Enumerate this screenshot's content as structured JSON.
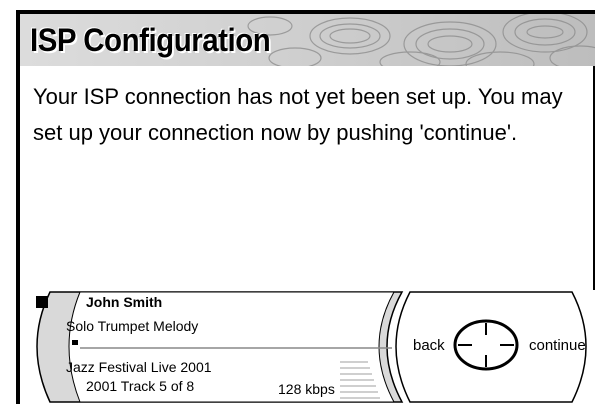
{
  "screen": {
    "title": "ISP Configuration",
    "message": "Your ISP connection has not yet been set up. You may set up your connection now by pushing 'continue'."
  },
  "player": {
    "artist": "John Smith",
    "track_title": "Solo Trumpet Melody",
    "album": "Jazz Festival Live 2001",
    "track_info": "2001   Track 5 of 8",
    "bitrate": "128 kbps",
    "progress": 0.02,
    "status_icon": "stop-icon"
  },
  "nav": {
    "back_label": "back",
    "continue_label": "continue",
    "dpad_icon": "dpad-crosshair-icon"
  },
  "colors": {
    "panel": "#d9d9d9",
    "banner": "#dcdcdc",
    "text": "#000000"
  }
}
